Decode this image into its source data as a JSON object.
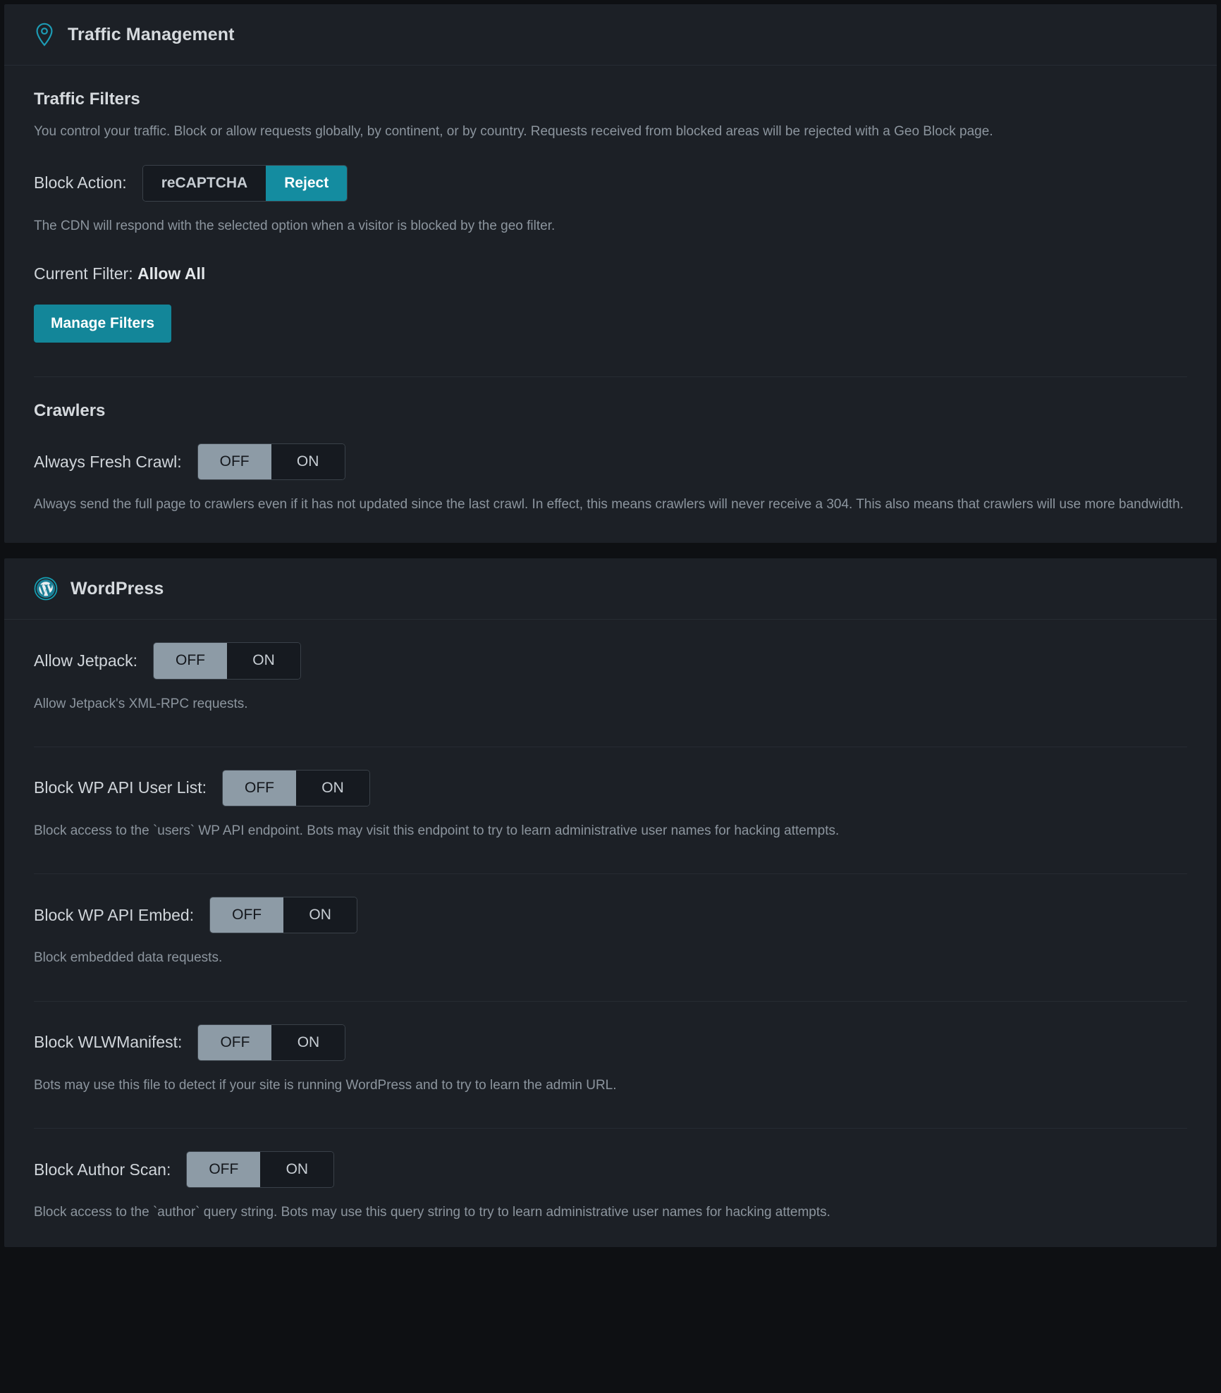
{
  "panels": [
    {
      "id": "traffic-management",
      "header": {
        "icon": "map-pin-icon",
        "title": "Traffic Management"
      },
      "sections": [
        {
          "id": "traffic-filters",
          "title": "Traffic Filters",
          "description": "You control your traffic. Block or allow requests globally, by continent, or by country. Requests received from blocked areas will be rejected with a Geo Block page.",
          "block_action": {
            "label": "Block Action:",
            "options": [
              "reCAPTCHA",
              "Reject"
            ],
            "selected": "Reject",
            "description": "The CDN will respond with the selected option when a visitor is blocked by the geo filter."
          },
          "current_filter": {
            "label": "Current Filter:",
            "value": "Allow All"
          },
          "manage_filters_label": "Manage Filters"
        },
        {
          "id": "crawlers",
          "title": "Crawlers",
          "always_fresh_crawl": {
            "label": "Always Fresh Crawl:",
            "options": [
              "OFF",
              "ON"
            ],
            "selected": "OFF",
            "description": "Always send the full page to crawlers even if it has not updated since the last crawl. In effect, this means crawlers will never receive a 304. This also means that crawlers will use more bandwidth."
          }
        }
      ]
    },
    {
      "id": "wordpress",
      "header": {
        "icon": "wordpress-logo-icon",
        "title": "WordPress"
      },
      "settings": [
        {
          "id": "allow-jetpack",
          "label": "Allow Jetpack:",
          "options": [
            "OFF",
            "ON"
          ],
          "selected": "OFF",
          "description": "Allow Jetpack's XML-RPC requests."
        },
        {
          "id": "block-wp-api-user-list",
          "label": "Block WP API User List:",
          "options": [
            "OFF",
            "ON"
          ],
          "selected": "OFF",
          "description": "Block access to the `users` WP API endpoint. Bots may visit this endpoint to try to learn administrative user names for hacking attempts."
        },
        {
          "id": "block-wp-api-embed",
          "label": "Block WP API Embed:",
          "options": [
            "OFF",
            "ON"
          ],
          "selected": "OFF",
          "description": "Block embedded data requests."
        },
        {
          "id": "block-wlwmanifest",
          "label": "Block WLWManifest:",
          "options": [
            "OFF",
            "ON"
          ],
          "selected": "OFF",
          "description": "Bots may use this file to detect if your site is running WordPress and to try to learn the admin URL."
        },
        {
          "id": "block-author-scan",
          "label": "Block Author Scan:",
          "options": [
            "OFF",
            "ON"
          ],
          "selected": "OFF",
          "description": "Block access to the `author` query string. Bots may use this query string to try to learn administrative user names for hacking attempts."
        }
      ]
    }
  ],
  "colors": {
    "page_background": "#0e1013",
    "panel_background": "#1c2026",
    "accent_teal": "#148ca0",
    "selected_grey": "#8d9ba6",
    "text_primary": "#d6dade",
    "text_muted": "#8c959e"
  }
}
